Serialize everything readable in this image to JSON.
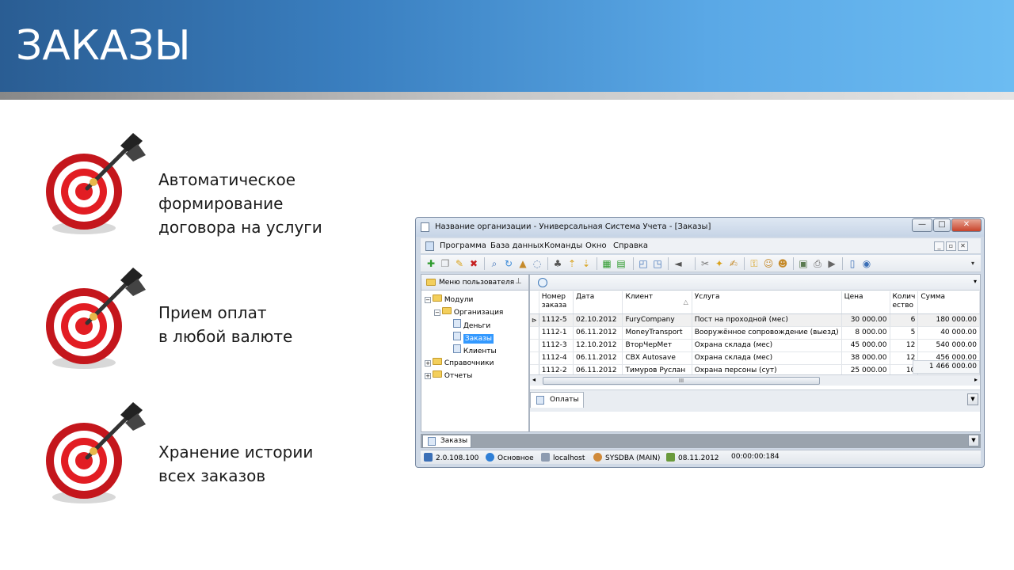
{
  "slide": {
    "title": "ЗАКАЗЫ",
    "bullets": [
      {
        "line1": "Автоматическое формирование",
        "line2": "договора на услуги",
        "icon": "target-icon"
      },
      {
        "line1": "Прием оплат",
        "line2": "в любой валюте",
        "icon": "target-icon"
      },
      {
        "line1": "Хранение истории",
        "line2": "всех заказов",
        "icon": "target-icon"
      }
    ]
  },
  "window": {
    "title": "Название организации - Универсальная Система Учета - [Заказы]",
    "buttons": {
      "minimize": "—",
      "maximize": "□",
      "close": "✕"
    },
    "menu": [
      "Программа",
      "База данных",
      "Команды",
      "Окно",
      "Справка"
    ],
    "mdi_buttons": [
      "_",
      "▫",
      "✕"
    ],
    "left_panel": {
      "header": "Меню пользователя",
      "tree": [
        {
          "label": "Модули",
          "level": 0,
          "type": "folder",
          "toggle": "−"
        },
        {
          "label": "Организация",
          "level": 1,
          "type": "folder",
          "toggle": "−"
        },
        {
          "label": "Деньги",
          "level": 2,
          "type": "doc"
        },
        {
          "label": "Заказы",
          "level": 2,
          "type": "doc",
          "selected": true
        },
        {
          "label": "Клиенты",
          "level": 2,
          "type": "doc"
        },
        {
          "label": "Справочники",
          "level": 0,
          "type": "folder",
          "toggle": "+"
        },
        {
          "label": "Отчеты",
          "level": 0,
          "type": "folder",
          "toggle": "+"
        }
      ]
    },
    "grid": {
      "columns": [
        "Номер заказа",
        "Дата",
        "Клиент",
        "Услуга",
        "Цена",
        "Количество",
        "Сумма"
      ],
      "column_labels": {
        "num_line1": "Номер",
        "num_line2": "заказа",
        "date": "Дата",
        "client": "Клиент",
        "sort_indicator": "△",
        "service": "Услуга",
        "price": "Цена",
        "qty_line1": "Колич",
        "qty_line2": "ество",
        "sum": "Сумма"
      },
      "rows": [
        {
          "num": "1112-5",
          "date": "02.10.2012",
          "client": "FuryCompany",
          "service": "Пост на проходной (мес)",
          "price": "30 000.00",
          "qty": "6",
          "sum": "180 000.00",
          "current": true
        },
        {
          "num": "1112-1",
          "date": "06.11.2012",
          "client": "MoneyTransport",
          "service": "Вооружённое сопровождение (выезд)",
          "price": "8 000.00",
          "qty": "5",
          "sum": "40 000.00"
        },
        {
          "num": "1112-3",
          "date": "12.10.2012",
          "client": "ВторЧерМет",
          "service": "Охрана склада (мес)",
          "price": "45 000.00",
          "qty": "12",
          "sum": "540 000.00"
        },
        {
          "num": "1112-4",
          "date": "06.11.2012",
          "client": "CBX Autosave",
          "service": "Охрана склада (мес)",
          "price": "38 000.00",
          "qty": "12",
          "sum": "456 000.00"
        },
        {
          "num": "1112-2",
          "date": "06.11.2012",
          "client": "Тимуров Руслан",
          "service": "Охрана персоны (сут)",
          "price": "25 000.00",
          "qty": "10",
          "sum": "250 000.00"
        }
      ],
      "total": "1 466 000.00",
      "scroll_thumb": "III",
      "row_indicator": "⊳"
    },
    "subtab": "Оплаты",
    "doctab": "Заказы",
    "status": {
      "version": "2.0.108.100",
      "profile": "Основное",
      "host": "localhost",
      "user": "SYSDBA (MAIN)",
      "date": "08.11.2012",
      "timer": "00:00:00:184"
    }
  }
}
